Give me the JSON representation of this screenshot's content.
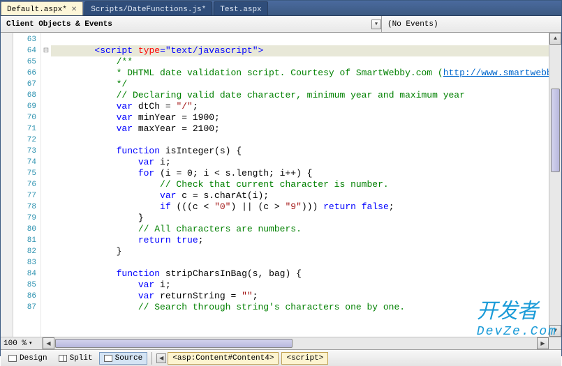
{
  "tabs": [
    {
      "label": "Default.aspx*",
      "active": true
    },
    {
      "label": "Scripts/DateFunctions.js*",
      "active": false
    },
    {
      "label": "Test.aspx",
      "active": false
    }
  ],
  "navbar": {
    "left": "Client Objects & Events",
    "right": "(No Events)"
  },
  "lines": [
    {
      "n": 63,
      "html": "            "
    },
    {
      "n": 64,
      "html": "        <span class='k-blue'>&lt;script</span> <span class='k-red'>type</span><span class='k-blue'>=</span><span class='k-blue'>\"text/javascript\"</span><span class='k-blue'>&gt;</span>",
      "hl": true,
      "fold": "⊟"
    },
    {
      "n": 65,
      "html": "            <span class='k-green'>/**</span>"
    },
    {
      "n": 66,
      "html": "            <span class='k-green'>* DHTML date validation script. Courtesy of SmartWebby.com (</span><span class='k-link'>http://www.smartwebby.com/dhtml/</span>"
    },
    {
      "n": 67,
      "html": "            <span class='k-green'>*/</span>"
    },
    {
      "n": 68,
      "html": "            <span class='k-green'>// Declaring valid date character, minimum year and maximum year</span>"
    },
    {
      "n": 69,
      "html": "            <span class='k-blue'>var</span> dtCh = <span class='k-maroon'>\"/\"</span>;"
    },
    {
      "n": 70,
      "html": "            <span class='k-blue'>var</span> minYear = 1900;"
    },
    {
      "n": 71,
      "html": "            <span class='k-blue'>var</span> maxYear = 2100;"
    },
    {
      "n": 72,
      "html": " "
    },
    {
      "n": 73,
      "html": "            <span class='k-blue'>function</span> isInteger(s) {"
    },
    {
      "n": 74,
      "html": "                <span class='k-blue'>var</span> i;"
    },
    {
      "n": 75,
      "html": "                <span class='k-blue'>for</span> (i = 0; i &lt; s.length; i++) {"
    },
    {
      "n": 76,
      "html": "                    <span class='k-green'>// Check that current character is number.</span>"
    },
    {
      "n": 77,
      "html": "                    <span class='k-blue'>var</span> c = s.charAt(i);"
    },
    {
      "n": 78,
      "html": "                    <span class='k-blue'>if</span> (((c &lt; <span class='k-maroon'>\"0\"</span>) || (c &gt; <span class='k-maroon'>\"9\"</span>))) <span class='k-blue'>return</span> <span class='k-blue'>false</span>;"
    },
    {
      "n": 79,
      "html": "                }"
    },
    {
      "n": 80,
      "html": "                <span class='k-green'>// All characters are numbers.</span>"
    },
    {
      "n": 81,
      "html": "                <span class='k-blue'>return</span> <span class='k-blue'>true</span>;"
    },
    {
      "n": 82,
      "html": "            }"
    },
    {
      "n": 83,
      "html": " "
    },
    {
      "n": 84,
      "html": "            <span class='k-blue'>function</span> stripCharsInBag(s, bag) {"
    },
    {
      "n": 85,
      "html": "                <span class='k-blue'>var</span> i;"
    },
    {
      "n": 86,
      "html": "                <span class='k-blue'>var</span> returnString = <span class='k-maroon'>\"\"</span>;"
    },
    {
      "n": 87,
      "html": "                <span class='k-green'>// Search through string's characters one by one.</span>"
    }
  ],
  "zoom": "100 %",
  "viewbar": {
    "design": "Design",
    "split": "Split",
    "source": "Source",
    "crumbs": [
      "<asp:Content#Content4>",
      "<script>"
    ]
  },
  "watermark": {
    "main": "开发者",
    "sub": "DevZe.Com"
  }
}
